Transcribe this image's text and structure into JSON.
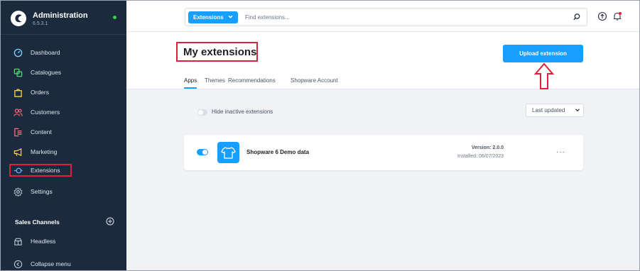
{
  "app": {
    "title": "Administration",
    "version": "6.5.3.1"
  },
  "sidebar": {
    "items": [
      {
        "label": "Dashboard",
        "icon": "dashboard-icon"
      },
      {
        "label": "Catalogues",
        "icon": "catalogues-icon"
      },
      {
        "label": "Orders",
        "icon": "orders-icon"
      },
      {
        "label": "Customers",
        "icon": "customers-icon"
      },
      {
        "label": "Content",
        "icon": "content-icon"
      },
      {
        "label": "Marketing",
        "icon": "marketing-icon"
      },
      {
        "label": "Extensions",
        "icon": "extensions-icon",
        "active": true
      },
      {
        "label": "Settings",
        "icon": "settings-icon"
      }
    ],
    "sales_channels_title": "Sales Channels",
    "sales_channels": [
      {
        "label": "Headless",
        "icon": "headless-icon"
      }
    ],
    "collapse_label": "Collapse menu"
  },
  "topbar": {
    "search_type": "Extensions",
    "search_placeholder": "Find extensions..."
  },
  "page": {
    "title": "My extensions",
    "upload_button": "Upload extension",
    "tabs": [
      {
        "label": "Apps",
        "active": true
      },
      {
        "label": "Themes"
      },
      {
        "label": "Recommendations"
      },
      {
        "label": "Shopware Account"
      }
    ],
    "hide_inactive_label": "Hide inactive extensions",
    "sort_label": "Last updated"
  },
  "extensions": [
    {
      "name": "Shopware 6 Demo data",
      "version": "Version: 2.0.0",
      "installed": "Installed: 06/07/2023",
      "active": true
    }
  ],
  "colors": {
    "sidebar_bg": "#1b2a3d",
    "accent": "#189eff",
    "annotation": "#e0203a",
    "status_online": "#37d046"
  }
}
